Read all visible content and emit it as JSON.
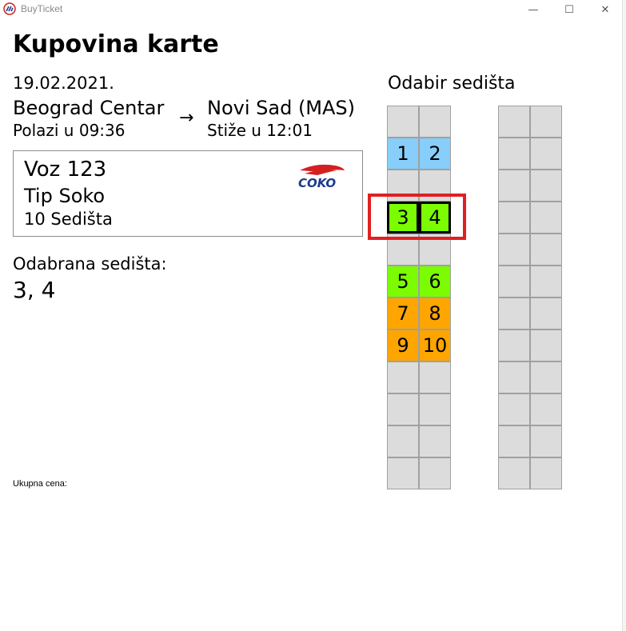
{
  "window": {
    "title": "BuyTicket",
    "minimize": "—",
    "maximize": "☐",
    "close": "✕"
  },
  "page": {
    "title": "Kupovina karte",
    "date": "19.02.2021.",
    "from_station": "Beograd Centar",
    "to_station": "Novi Sad (MAS)",
    "arrow": "→",
    "departs": "Polazi u 09:36",
    "arrives": "Stiže u 12:01"
  },
  "train": {
    "name": "Voz 123",
    "type": "Tip Soko",
    "seats": "10 Sedišta",
    "logo_text": "COKO"
  },
  "selection": {
    "label": "Odabrana sedišta:",
    "value": "3, 4"
  },
  "total": {
    "label": "Ukupna cena:"
  },
  "seat_map": {
    "title": "Odabir sedišta",
    "left_column": [
      [
        {
          "label": "",
          "state": "empty"
        },
        {
          "label": "",
          "state": "empty"
        }
      ],
      [
        {
          "label": "1",
          "state": "available"
        },
        {
          "label": "2",
          "state": "available"
        }
      ],
      [
        {
          "label": "",
          "state": "empty"
        },
        {
          "label": "",
          "state": "empty"
        }
      ],
      [
        {
          "label": "3",
          "state": "selected"
        },
        {
          "label": "4",
          "state": "selected"
        }
      ],
      [
        {
          "label": "",
          "state": "empty"
        },
        {
          "label": "",
          "state": "empty"
        }
      ],
      [
        {
          "label": "5",
          "state": "free-green"
        },
        {
          "label": "6",
          "state": "free-green"
        }
      ],
      [
        {
          "label": "7",
          "state": "occupied"
        },
        {
          "label": "8",
          "state": "occupied"
        }
      ],
      [
        {
          "label": "9",
          "state": "occupied"
        },
        {
          "label": "10",
          "state": "occupied"
        }
      ],
      [
        {
          "label": "",
          "state": "empty"
        },
        {
          "label": "",
          "state": "empty"
        }
      ],
      [
        {
          "label": "",
          "state": "empty"
        },
        {
          "label": "",
          "state": "empty"
        }
      ],
      [
        {
          "label": "",
          "state": "empty"
        },
        {
          "label": "",
          "state": "empty"
        }
      ],
      [
        {
          "label": "",
          "state": "empty"
        },
        {
          "label": "",
          "state": "empty"
        }
      ]
    ],
    "right_column_rows": 12,
    "colors": {
      "empty": "#dcdcdc",
      "available": "#87cefa",
      "free_green": "#7cfc00",
      "occupied": "#ffa500",
      "highlight": "#e02020"
    }
  }
}
